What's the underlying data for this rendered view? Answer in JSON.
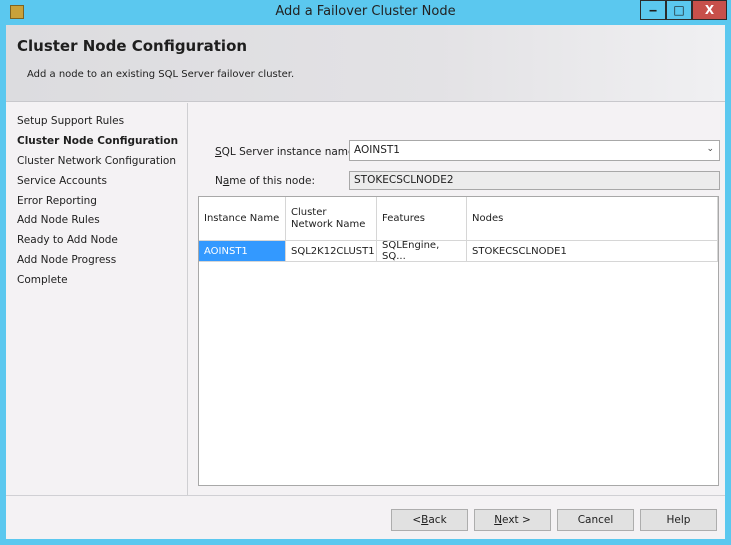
{
  "window": {
    "title": "Add a Failover Cluster Node",
    "minimize": "‒",
    "maximize": "□",
    "close": "X"
  },
  "header": {
    "title": "Cluster Node Configuration",
    "subtitle": "Add a node to an existing SQL Server failover cluster."
  },
  "nav": {
    "items": [
      {
        "label": "Setup Support Rules"
      },
      {
        "label": "Cluster Node Configuration",
        "active": true
      },
      {
        "label": "Cluster Network Configuration"
      },
      {
        "label": "Service Accounts"
      },
      {
        "label": "Error Reporting"
      },
      {
        "label": "Add Node Rules"
      },
      {
        "label": "Ready to Add Node"
      },
      {
        "label": "Add Node Progress"
      },
      {
        "label": "Complete"
      }
    ]
  },
  "form": {
    "instance_label_key": "S",
    "instance_label_rest": "QL Server instance name:",
    "instance_value": "AOINST1",
    "node_label_pre": "N",
    "node_label_key": "a",
    "node_label_rest": "me of this node:",
    "node_value": "STOKECSCLNODE2"
  },
  "grid": {
    "columns": [
      "Instance Name",
      "Cluster Network Name",
      "Features",
      "Nodes"
    ],
    "rows": [
      [
        "AOINST1",
        "SQL2K12CLUST1",
        "SQLEngine, SQ...",
        "STOKECSCLNODE1"
      ]
    ]
  },
  "buttons": {
    "back_pre": "< ",
    "back_key": "B",
    "back_rest": "ack",
    "next_key": "N",
    "next_rest": "ext >",
    "cancel": "Cancel",
    "help": "Help"
  }
}
